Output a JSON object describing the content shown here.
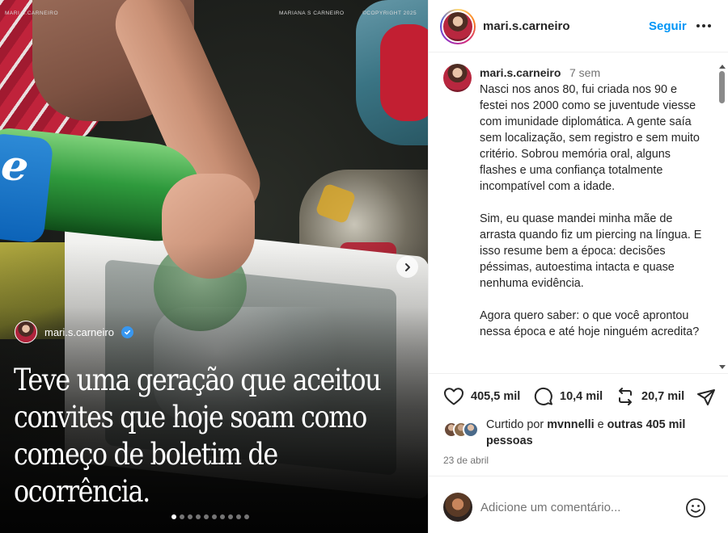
{
  "media": {
    "credits": {
      "left": "MARI.S.CARNEIRO",
      "middle": "MARIANA S CARNEIRO",
      "right": "©COPYRIGHT 2025"
    },
    "bottle_label_text": "e",
    "overlay_username": "mari.s.carneiro",
    "headline": "Teve uma geração que aceitou convites que hoje soam como começo de boletim de ocorrência.",
    "carousel_dots": 10,
    "active_dot": 1
  },
  "header": {
    "username": "mari.s.carneiro",
    "follow_label": "Seguir",
    "more_icon": "more-horizontal-icon"
  },
  "post": {
    "username": "mari.s.carneiro",
    "time_ago": "7 sem",
    "caption_paragraphs": [
      "Nasci nos anos 80, fui criada nos 90 e festei nos 2000 como se juventude viesse com imunidade diplomática. A gente saía sem localização, sem registro e sem muito critério. Sobrou memória oral, alguns flashes e uma confiança totalmente incompatível com a idade.",
      "Sim, eu quase mandei minha mãe de arrasta quando fiz um piercing na língua. E isso resume bem a época: decisões péssimas, autoestima intacta e quase nenhuma evidência.",
      "Agora quero saber: o que você aprontou nessa época e até hoje ninguém acredita?"
    ]
  },
  "actions": {
    "likes": "405,5 mil",
    "comments": "10,4 mil",
    "reposts": "20,7 mil"
  },
  "likes_summary": {
    "prefix": "Curtido por",
    "user": "mvnnelli",
    "connector": "e",
    "others": "outras 405 mil pessoas"
  },
  "date": "23 de abril",
  "comment_box": {
    "placeholder": "Adicione um comentário..."
  },
  "colors": {
    "accent": "#0095f6",
    "text": "#262626",
    "muted": "#737373",
    "verified": "#3897f0"
  }
}
